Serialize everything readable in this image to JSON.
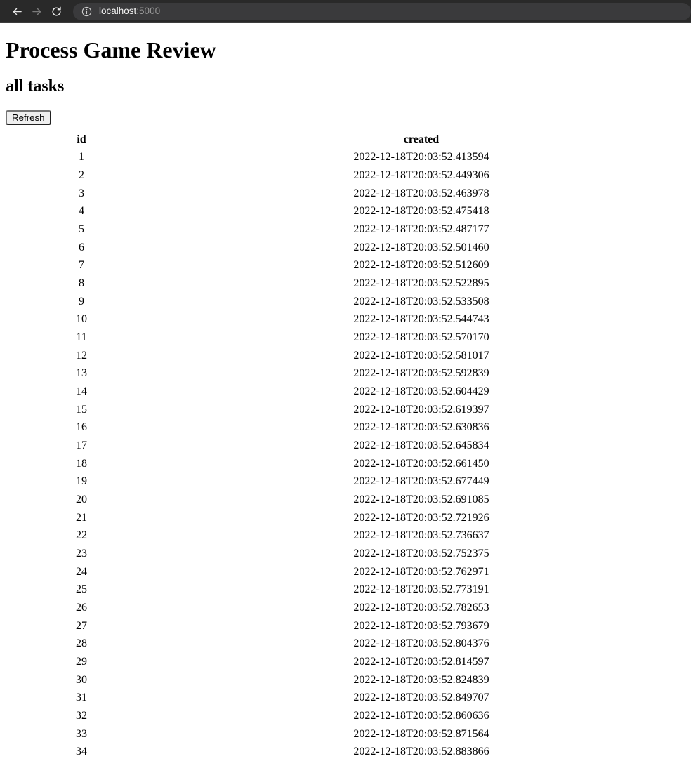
{
  "browser": {
    "back_icon": "back-arrow-icon",
    "forward_icon": "forward-arrow-icon",
    "reload_icon": "reload-icon",
    "site_info_icon": "info-circle-icon",
    "url_host": "localhost",
    "url_port": ":5000",
    "url_full": "localhost:5000"
  },
  "page": {
    "title": "Process Game Review",
    "section_title": "all tasks",
    "refresh_label": "Refresh"
  },
  "table": {
    "columns": [
      "id",
      "created"
    ],
    "rows": [
      {
        "id": "1",
        "created": "2022-12-18T20:03:52.413594"
      },
      {
        "id": "2",
        "created": "2022-12-18T20:03:52.449306"
      },
      {
        "id": "3",
        "created": "2022-12-18T20:03:52.463978"
      },
      {
        "id": "4",
        "created": "2022-12-18T20:03:52.475418"
      },
      {
        "id": "5",
        "created": "2022-12-18T20:03:52.487177"
      },
      {
        "id": "6",
        "created": "2022-12-18T20:03:52.501460"
      },
      {
        "id": "7",
        "created": "2022-12-18T20:03:52.512609"
      },
      {
        "id": "8",
        "created": "2022-12-18T20:03:52.522895"
      },
      {
        "id": "9",
        "created": "2022-12-18T20:03:52.533508"
      },
      {
        "id": "10",
        "created": "2022-12-18T20:03:52.544743"
      },
      {
        "id": "11",
        "created": "2022-12-18T20:03:52.570170"
      },
      {
        "id": "12",
        "created": "2022-12-18T20:03:52.581017"
      },
      {
        "id": "13",
        "created": "2022-12-18T20:03:52.592839"
      },
      {
        "id": "14",
        "created": "2022-12-18T20:03:52.604429"
      },
      {
        "id": "15",
        "created": "2022-12-18T20:03:52.619397"
      },
      {
        "id": "16",
        "created": "2022-12-18T20:03:52.630836"
      },
      {
        "id": "17",
        "created": "2022-12-18T20:03:52.645834"
      },
      {
        "id": "18",
        "created": "2022-12-18T20:03:52.661450"
      },
      {
        "id": "19",
        "created": "2022-12-18T20:03:52.677449"
      },
      {
        "id": "20",
        "created": "2022-12-18T20:03:52.691085"
      },
      {
        "id": "21",
        "created": "2022-12-18T20:03:52.721926"
      },
      {
        "id": "22",
        "created": "2022-12-18T20:03:52.736637"
      },
      {
        "id": "23",
        "created": "2022-12-18T20:03:52.752375"
      },
      {
        "id": "24",
        "created": "2022-12-18T20:03:52.762971"
      },
      {
        "id": "25",
        "created": "2022-12-18T20:03:52.773191"
      },
      {
        "id": "26",
        "created": "2022-12-18T20:03:52.782653"
      },
      {
        "id": "27",
        "created": "2022-12-18T20:03:52.793679"
      },
      {
        "id": "28",
        "created": "2022-12-18T20:03:52.804376"
      },
      {
        "id": "29",
        "created": "2022-12-18T20:03:52.814597"
      },
      {
        "id": "30",
        "created": "2022-12-18T20:03:52.824839"
      },
      {
        "id": "31",
        "created": "2022-12-18T20:03:52.849707"
      },
      {
        "id": "32",
        "created": "2022-12-18T20:03:52.860636"
      },
      {
        "id": "33",
        "created": "2022-12-18T20:03:52.871564"
      },
      {
        "id": "34",
        "created": "2022-12-18T20:03:52.883866"
      }
    ]
  },
  "colors": {
    "toolbar_bg": "#292929",
    "omnibox_bg": "#3a3a3c",
    "page_bg": "#ffffff",
    "text": "#000000",
    "url_muted": "#9a9a9a"
  }
}
